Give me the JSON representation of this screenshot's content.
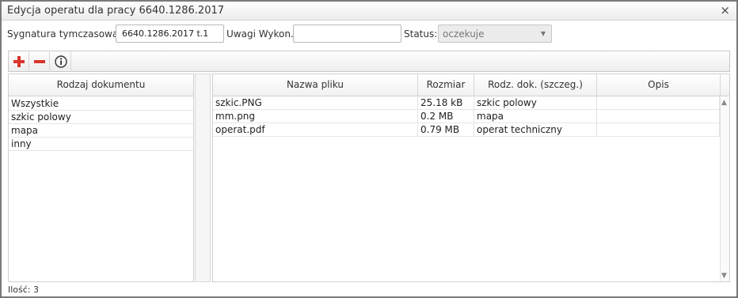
{
  "dialog": {
    "title": "Edycja operatu dla pracy 6640.1286.2017",
    "close": "×"
  },
  "form": {
    "sygnatura_label": "Sygnatura tymczasowa:",
    "sygnatura_value": "6640.1286.2017 t.1",
    "uwagi_label": "Uwagi Wykon.:",
    "uwagi_value": "",
    "status_label": "Status:",
    "status_value": "oczekuje"
  },
  "toolbar": {
    "add_icon": "plus-icon",
    "remove_icon": "minus-icon",
    "info_icon": "info-icon"
  },
  "doc_types": {
    "header": "Rodzaj dokumentu",
    "items": [
      "Wszystkie",
      "szkic polowy",
      "mapa",
      "inny"
    ]
  },
  "files": {
    "columns": [
      "Nazwa pliku",
      "Rozmiar",
      "Rodz. dok. (szczeg.)",
      "Opis"
    ],
    "rows": [
      [
        "szkic.PNG",
        "25.18 kB",
        "szkic polowy",
        ""
      ],
      [
        "mm.png",
        "0.2 MB",
        "mapa",
        ""
      ],
      [
        "operat.pdf",
        "0.79 MB",
        "operat techniczny",
        ""
      ]
    ]
  },
  "footer": {
    "count": "Ilość: 3"
  },
  "colors": {
    "accent_red": "#d9342b",
    "header_bg": "#f1f1f1"
  }
}
